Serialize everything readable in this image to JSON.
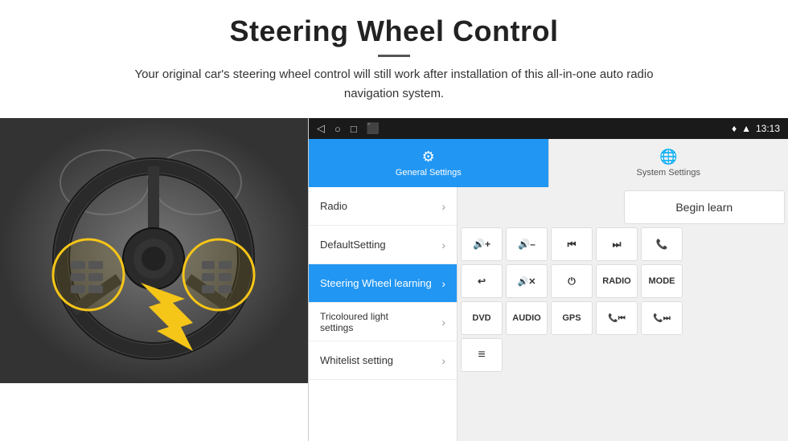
{
  "header": {
    "title": "Steering Wheel Control",
    "subtitle": "Your original car's steering wheel control will still work after installation of this all-in-one auto radio navigation system."
  },
  "android_panel": {
    "statusbar": {
      "time": "13:13",
      "icons": [
        "◁",
        "○",
        "□",
        "⬛"
      ]
    },
    "tabs": [
      {
        "id": "general",
        "label": "General Settings",
        "icon": "⚙",
        "active": true
      },
      {
        "id": "system",
        "label": "System Settings",
        "icon": "🌐",
        "active": false
      }
    ],
    "menu_items": [
      {
        "label": "Radio",
        "active": false
      },
      {
        "label": "DefaultSetting",
        "active": false
      },
      {
        "label": "Steering Wheel learning",
        "active": true
      },
      {
        "label": "Tricoloured light settings",
        "active": false
      },
      {
        "label": "Whitelist setting",
        "active": false
      }
    ],
    "control_panel": {
      "rows": [
        {
          "cols": [
            {
              "type": "empty"
            },
            {
              "type": "btn",
              "label": "Begin learn",
              "size": "begin-learn"
            }
          ]
        },
        {
          "cols": [
            {
              "type": "btn",
              "label": "🔊+",
              "size": "sq"
            },
            {
              "type": "btn",
              "label": "🔊–",
              "size": "sq"
            },
            {
              "type": "btn",
              "label": "⏮",
              "size": "sq"
            },
            {
              "type": "btn",
              "label": "⏭",
              "size": "sq"
            },
            {
              "type": "btn",
              "label": "📞",
              "size": "sq"
            }
          ]
        },
        {
          "cols": [
            {
              "type": "btn",
              "label": "↩",
              "size": "sq"
            },
            {
              "type": "btn",
              "label": "🔊✕",
              "size": "sq"
            },
            {
              "type": "btn",
              "label": "⏻",
              "size": "sq"
            },
            {
              "type": "btn",
              "label": "RADIO",
              "size": "sq"
            },
            {
              "type": "btn",
              "label": "MODE",
              "size": "sq"
            }
          ]
        },
        {
          "cols": [
            {
              "type": "btn",
              "label": "DVD",
              "size": "sq"
            },
            {
              "type": "btn",
              "label": "AUDIO",
              "size": "sq"
            },
            {
              "type": "btn",
              "label": "GPS",
              "size": "sq"
            },
            {
              "type": "btn",
              "label": "📞⏮",
              "size": "sq"
            },
            {
              "type": "btn",
              "label": "📞⏭",
              "size": "sq"
            }
          ]
        },
        {
          "cols": [
            {
              "type": "btn",
              "label": "≡",
              "size": "sq"
            }
          ]
        }
      ]
    }
  }
}
